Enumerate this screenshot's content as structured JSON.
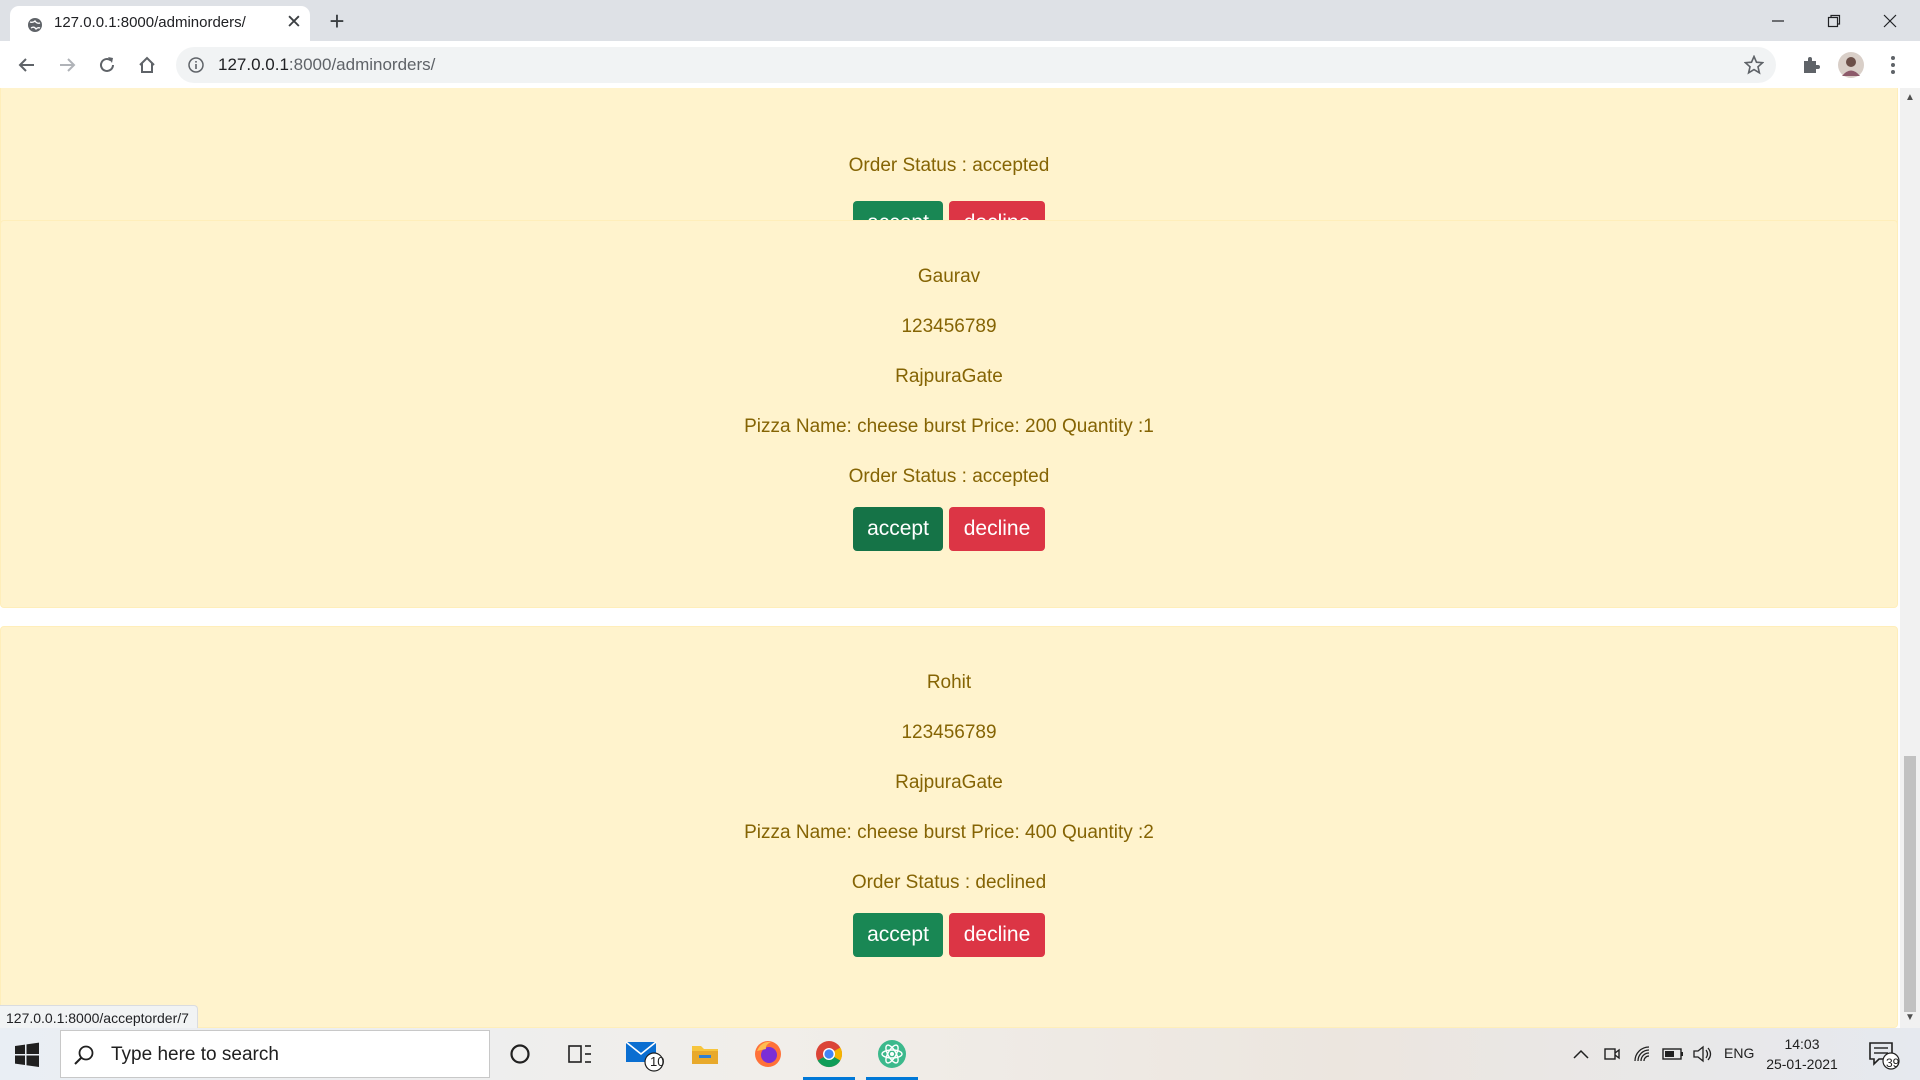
{
  "browser": {
    "tab_title": "127.0.0.1:8000/adminorders/",
    "url_host": "127.0.0.1",
    "url_path": ":8000/adminorders/",
    "status_link": "127.0.0.1:8000/acceptorder/7"
  },
  "orders": [
    {
      "partial_status": "Order Status : accepted",
      "accept_label": "accept",
      "decline_label": "decline"
    },
    {
      "name": "Gaurav",
      "phone": "123456789",
      "address": "RajpuraGate",
      "item": "Pizza Name: cheese burst Price: 200 Quantity :1",
      "status": "Order Status : accepted",
      "accept_label": "accept",
      "decline_label": "decline"
    },
    {
      "name": "Rohit",
      "phone": "123456789",
      "address": "RajpuraGate",
      "item": "Pizza Name: cheese burst Price: 400 Quantity :2",
      "status": "Order Status : declined",
      "accept_label": "accept",
      "decline_label": "decline"
    }
  ],
  "taskbar": {
    "search_placeholder": "Type here to search",
    "mail_badge": "10",
    "language": "ENG",
    "time": "14:03",
    "date": "25-01-2021",
    "notifications_badge": "39"
  },
  "colors": {
    "card_background": "#fff3cd",
    "card_text": "#856404",
    "accept": "#198754",
    "decline": "#dc3545"
  }
}
